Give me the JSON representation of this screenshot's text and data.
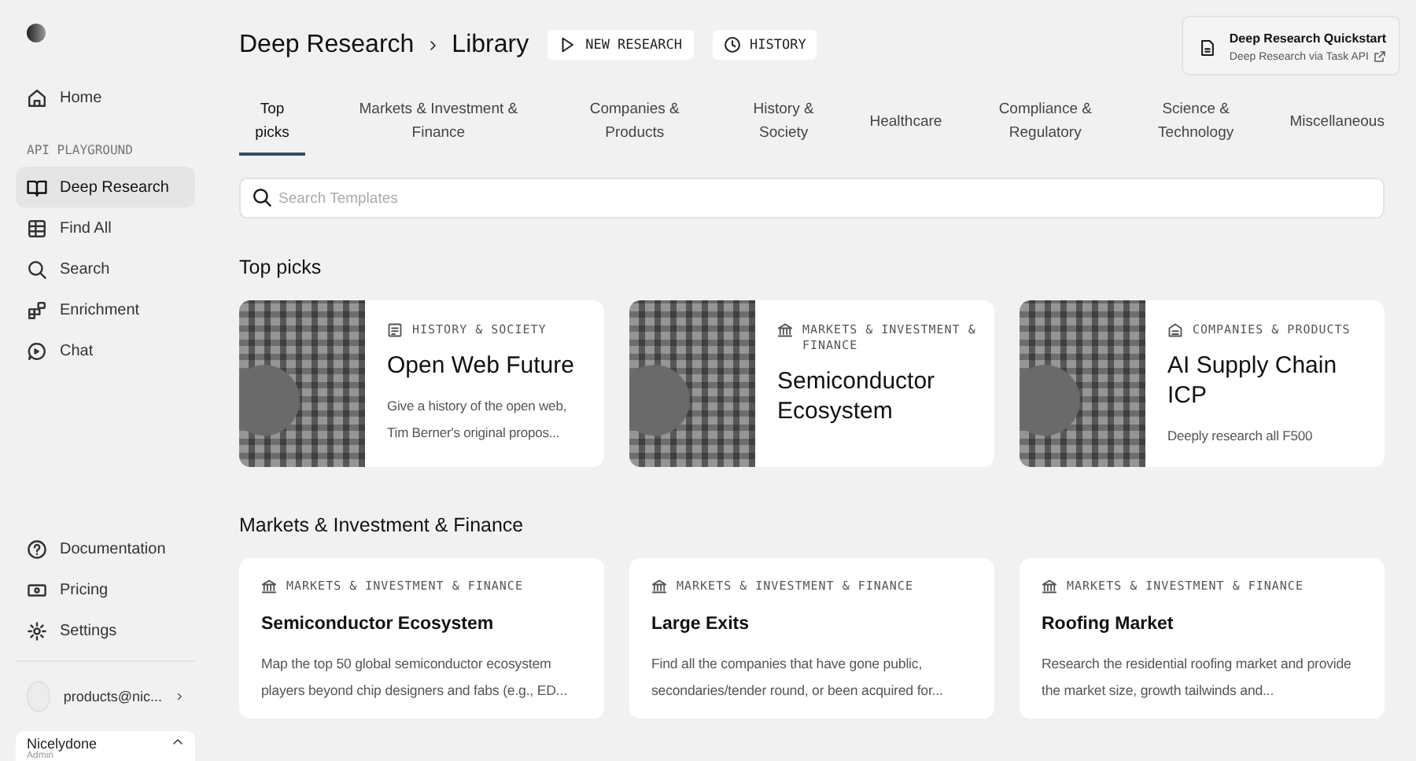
{
  "sidebar": {
    "items": [
      {
        "label": "Home",
        "selected": false
      }
    ],
    "section_label": "API PLAYGROUND",
    "playground_items": [
      {
        "label": "Deep Research",
        "selected": true
      },
      {
        "label": "Find All",
        "selected": false
      },
      {
        "label": "Search",
        "selected": false
      },
      {
        "label": "Enrichment",
        "selected": false
      },
      {
        "label": "Chat",
        "selected": false
      }
    ],
    "bottom_items": [
      {
        "label": "Documentation"
      },
      {
        "label": "Pricing"
      },
      {
        "label": "Settings"
      }
    ],
    "account": {
      "email": "products@nic...",
      "org": "Nicelydone",
      "role": "Admin"
    }
  },
  "breadcrumb": [
    "Deep Research",
    "Library"
  ],
  "header_buttons": [
    "NEW RESEARCH",
    "HISTORY"
  ],
  "quickstart": {
    "title": "Deep Research Quickstart",
    "link": "Deep Research via Task API"
  },
  "tabs": [
    {
      "label": "Top picks",
      "selected": true
    },
    {
      "label": "Markets & Investment & Finance",
      "selected": false
    },
    {
      "label": "Companies & Products",
      "selected": false
    },
    {
      "label": "History & Society",
      "selected": false
    },
    {
      "label": "Healthcare",
      "selected": false
    },
    {
      "label": "Compliance & Regulatory",
      "selected": false
    },
    {
      "label": "Science & Technology",
      "selected": false
    },
    {
      "label": "Miscellaneous",
      "selected": false
    }
  ],
  "search": {
    "placeholder": "Search Templates"
  },
  "sections": [
    {
      "title": "Top picks",
      "kind": "featured",
      "cards": [
        {
          "category": "HISTORY & SOCIETY",
          "kind": "history",
          "title": "Open Web Future",
          "description": "Give a history of the open web, Tim Berner's original propos..."
        },
        {
          "category": "MARKETS & INVESTMENT & FINANCE",
          "kind": "markets",
          "title": "Semiconductor Ecosystem"
        },
        {
          "category": "COMPANIES & PRODUCTS",
          "kind": "companies",
          "title": "AI Supply Chain ICP",
          "description": "Deeply research all F500"
        }
      ]
    },
    {
      "title": "Markets & Investment & Finance",
      "kind": "list",
      "cards": [
        {
          "category": "MARKETS & INVESTMENT & FINANCE",
          "kind": "markets",
          "title": "Semiconductor Ecosystem",
          "description": "Map the top 50 global semiconductor ecosystem players beyond chip designers and fabs (e.g., ED..."
        },
        {
          "category": "MARKETS & INVESTMENT & FINANCE",
          "kind": "markets",
          "title": "Large Exits",
          "description": "Find all the companies that have gone public, secondaries/tender round, or been acquired for..."
        },
        {
          "category": "MARKETS & INVESTMENT & FINANCE",
          "kind": "markets",
          "title": "Roofing Market",
          "description": "Research the residential roofing market and provide the market size, growth tailwinds and..."
        }
      ]
    }
  ]
}
